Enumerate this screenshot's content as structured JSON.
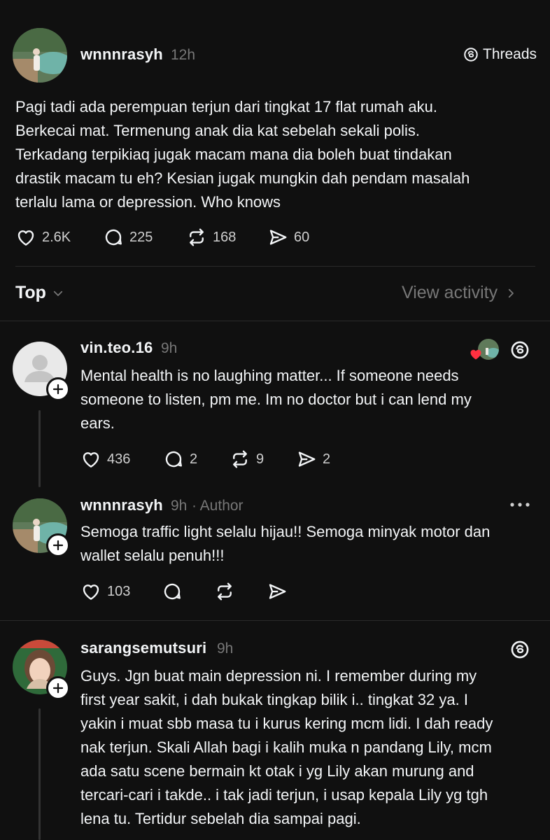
{
  "post": {
    "username": "wnnnrasyh",
    "time": "12h",
    "brand": "Threads",
    "lines": [
      "Pagi tadi ada perempuan terjun dari tingkat 17 flat rumah aku.",
      "Berkecai mat. Termenung anak dia kat sebelah sekali polis.",
      "Terkadang terpikiaq jugak macam mana dia boleh buat tindakan",
      "drastik macam tu eh? Kesian jugak mungkin dah pendam masalah",
      "terlalu lama or depression. Who knows"
    ],
    "likes": "2.6K",
    "replies": "225",
    "reposts": "168",
    "shares": "60"
  },
  "sort": {
    "label": "Top",
    "view_activity": "View activity"
  },
  "replies": [
    {
      "username": "vin.teo.16",
      "time": "9h",
      "lines": [
        "Mental health is no laughing matter... If someone needs",
        "someone to listen, pm me. Im no doctor but i can lend my",
        "ears."
      ],
      "likes": "436",
      "replies": "2",
      "reposts": "9",
      "shares": "2"
    },
    {
      "username": "wnnnrasyh",
      "time": "9h",
      "tag": "· Author",
      "lines": [
        "Semoga traffic light selalu hijau!! Semoga minyak motor dan",
        "wallet selalu penuh!!!"
      ],
      "likes": "103"
    },
    {
      "username": "sarangsemutsuri",
      "time": "9h",
      "lines": [
        "Guys. Jgn buat main depression ni. I remember during my",
        "first year sakit, i dah bukak tingkap bilik i.. tingkat 32 ya. I",
        "yakin i muat sbb masa tu i kurus kering mcm lidi. I dah ready",
        "nak terjun. Skali Allah bagi i kalih muka n pandang Lily, mcm",
        "ada satu scene bermain kt otak i yg Lily akan murung and",
        "tercari-cari i takde.. i tak jadi terjun, i usap kepala Lily yg tgh",
        "lena tu. Tertidur sebelah dia sampai pagi."
      ]
    }
  ],
  "colors": {
    "background": "#101010",
    "text": "#f3f5f7",
    "muted": "#777777",
    "heart_red": "#ff3040"
  }
}
